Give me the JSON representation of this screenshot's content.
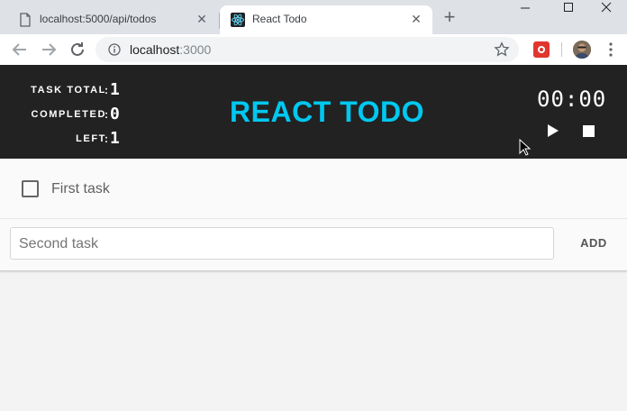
{
  "browser": {
    "tabs": [
      {
        "title": "localhost:5000/api/todos",
        "active": false
      },
      {
        "title": "React Todo",
        "active": true
      }
    ],
    "address": {
      "host": "localhost",
      "port": ":3000"
    }
  },
  "header": {
    "stats": {
      "total_label": "TASK TOTAL",
      "total_value": "1",
      "completed_label": "COMPLETED",
      "completed_value": "0",
      "left_label": "LEFT",
      "left_value": "1"
    },
    "title": "REACT TODO",
    "timer": "00:00"
  },
  "todos": [
    {
      "label": "First task",
      "completed": false
    }
  ],
  "new_todo": {
    "value": "Second task",
    "add_label": "ADD"
  },
  "colors": {
    "header_bg": "#222222",
    "title_accent": "#00c8f0",
    "chrome_tabstrip": "#dee1e6"
  },
  "icons": [
    "page-icon",
    "react-logo-icon",
    "close-icon",
    "plus-icon",
    "minimize-icon",
    "maximize-icon",
    "back-arrow-icon",
    "forward-arrow-icon",
    "reload-icon",
    "info-icon",
    "star-icon",
    "extension-icon",
    "avatar",
    "menu-icon",
    "play-icon",
    "stop-icon",
    "mouse-cursor-icon"
  ]
}
